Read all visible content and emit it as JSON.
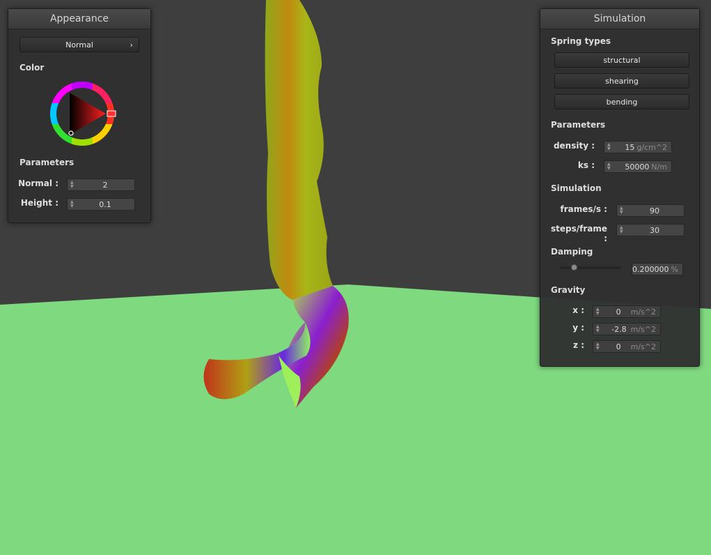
{
  "appearance": {
    "title": "Appearance",
    "mode_label": "Normal",
    "color_label": "Color",
    "parameters_label": "Parameters",
    "normal": {
      "label": "Normal :",
      "value": "2"
    },
    "height": {
      "label": "Height :",
      "value": "0.1"
    }
  },
  "simulation": {
    "title": "Simulation",
    "spring_types_label": "Spring types",
    "spring_buttons": [
      "structural",
      "shearing",
      "bending"
    ],
    "parameters_label": "Parameters",
    "density": {
      "label": "density :",
      "value": "15",
      "unit": "g/cm^2"
    },
    "ks": {
      "label": "ks :",
      "value": "50000",
      "unit": "N/m"
    },
    "simulation_label": "Simulation",
    "frames": {
      "label": "frames/s :",
      "value": "90"
    },
    "steps": {
      "label": "steps/frame :",
      "value": "30"
    },
    "damping_label": "Damping",
    "damping": {
      "value": "0.200000",
      "unit": "%",
      "slider_fraction": 0.2
    },
    "gravity_label": "Gravity",
    "gravity_x": {
      "label": "x :",
      "value": "0",
      "unit": "m/s^2"
    },
    "gravity_y": {
      "label": "y :",
      "value": "-2.8",
      "unit": "m/s^2"
    },
    "gravity_z": {
      "label": "z :",
      "value": "0",
      "unit": "m/s^2"
    }
  },
  "colors": {
    "background": "#3e3e3e",
    "floor": "#7fd97f",
    "panel": "#303030"
  }
}
